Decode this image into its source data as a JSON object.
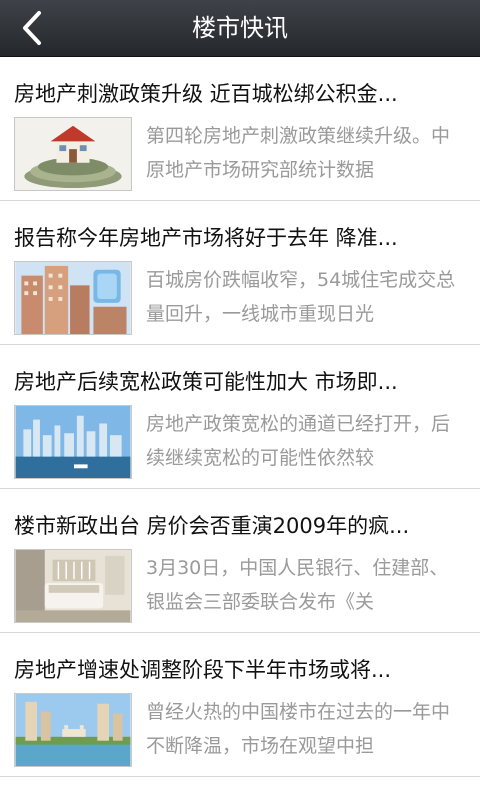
{
  "header": {
    "title": "楼市快讯"
  },
  "items": [
    {
      "title": "房地产刺激政策升级 近百城松绑公积金...",
      "summary": "第四轮房地产刺激政策继续升级。中原地产市场研究部统计数据",
      "image": "house-on-money-image"
    },
    {
      "title": "报告称今年房地产市场将好于去年 降准...",
      "summary": "百城房价跌幅收窄，54城住宅成交总量回升，一线城市重现日光",
      "image": "apartment-buildings-image"
    },
    {
      "title": "房地产后续宽松政策可能性加大 市场即...",
      "summary": "房地产政策宽松的通道已经打开，后续继续宽松的可能性依然较",
      "image": "city-skyline-image"
    },
    {
      "title": "楼市新政出台 房价会否重演2009年的疯...",
      "summary": "3月30日，中国人民银行、住建部、银监会三部委联合发布《关",
      "image": "bedroom-interior-image"
    },
    {
      "title": "房地产增速处调整阶段下半年市场或将...",
      "summary": "曾经火热的中国楼市在过去的一年中不断降温，市场在观望中担",
      "image": "waterfront-towers-image"
    }
  ]
}
